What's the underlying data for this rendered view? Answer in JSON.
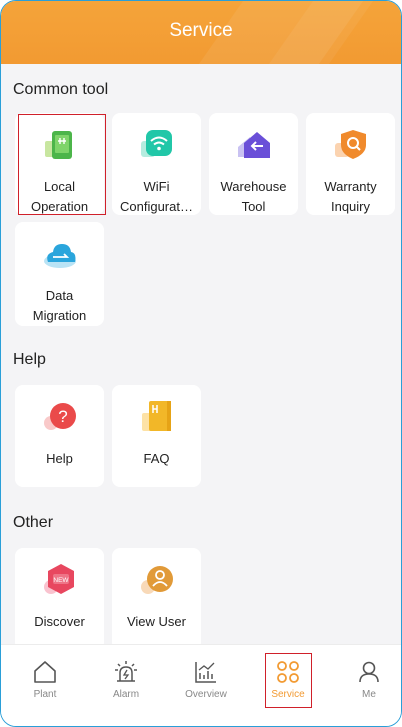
{
  "header": {
    "title": "Service"
  },
  "sections": {
    "common": {
      "title": "Common tool",
      "items": [
        {
          "line1": "Local",
          "line2": "Operation"
        },
        {
          "line1": "WiFi",
          "line2": "Configurat…"
        },
        {
          "line1": "Warehouse",
          "line2": "Tool"
        },
        {
          "line1": "Warranty",
          "line2": "Inquiry"
        },
        {
          "line1": "Data",
          "line2": "Migration"
        }
      ]
    },
    "help": {
      "title": "Help",
      "items": [
        {
          "label": "Help"
        },
        {
          "label": "FAQ"
        }
      ]
    },
    "other": {
      "title": "Other",
      "items": [
        {
          "label": "Discover"
        },
        {
          "label": "View User"
        }
      ]
    }
  },
  "tabbar": {
    "tabs": [
      {
        "label": "Plant",
        "icon": "house-icon"
      },
      {
        "label": "Alarm",
        "icon": "alarm-icon"
      },
      {
        "label": "Overview",
        "icon": "chart-icon"
      },
      {
        "label": "Service",
        "icon": "grid-icon"
      },
      {
        "label": "Me",
        "icon": "person-icon"
      }
    ],
    "active": "Service"
  },
  "colors": {
    "accent": "#f29a32",
    "highlight": "#d0202a",
    "border": "#2a9fd8"
  }
}
